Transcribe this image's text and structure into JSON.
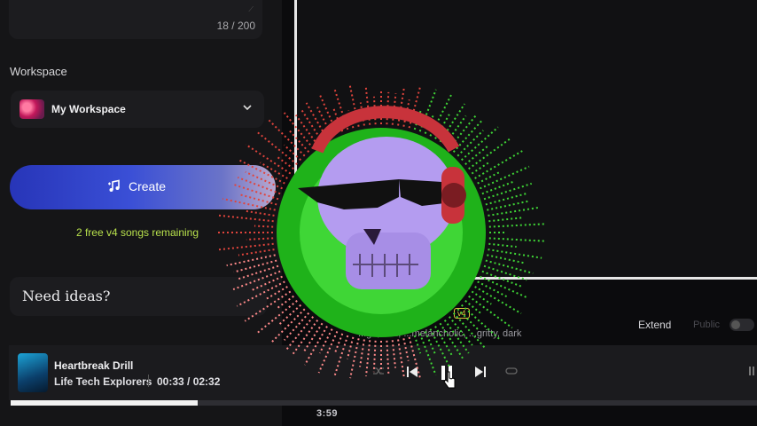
{
  "prompt": {
    "char_count": "18 / 200"
  },
  "workspace": {
    "section_label": "Workspace",
    "selected": "My Workspace"
  },
  "create": {
    "label": "Create",
    "free_songs": "2 free v4 songs remaining"
  },
  "ideas": {
    "title": "Need ideas?"
  },
  "song_card": {
    "tags": "...ge, ...al, ...melancholic, ...gritty, dark",
    "version_badge": "v4",
    "extend_label": "Extend",
    "public_label": "Public"
  },
  "player": {
    "title": "Heartbreak Drill",
    "artist": "Life Tech Explorers",
    "time": "00:33 / 02:32",
    "progress": 0.25
  },
  "visualizer": {
    "duration": "3:59"
  },
  "colors": {
    "create_start": "#2735b8",
    "accent_green": "#b7e04c",
    "ring_green": "#33d62b"
  }
}
